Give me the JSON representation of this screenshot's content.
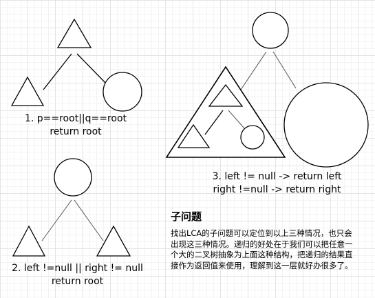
{
  "cases": [
    {
      "lines": [
        "1. p==root||q==root",
        "return root"
      ]
    },
    {
      "lines": [
        "2. left !=null || right != null",
        "return root"
      ]
    },
    {
      "lines": [
        "3. left != null -> return left",
        "right !=null -> return right"
      ]
    }
  ],
  "subproblem": {
    "title": "子问题",
    "body": "找出LCA的子问题可以定位到以上三种情况，也只会出现这三种情况。递归的好处在于我们可以把任意一个大的二叉树抽象为上面这种结构，把递归的结果直接作为返回值来使用，理解到这一层就好办很多了。"
  },
  "colors": {
    "stroke": "#000000",
    "edge": "#555555",
    "background": "#ffffff",
    "grid": "#e4e4e4"
  }
}
